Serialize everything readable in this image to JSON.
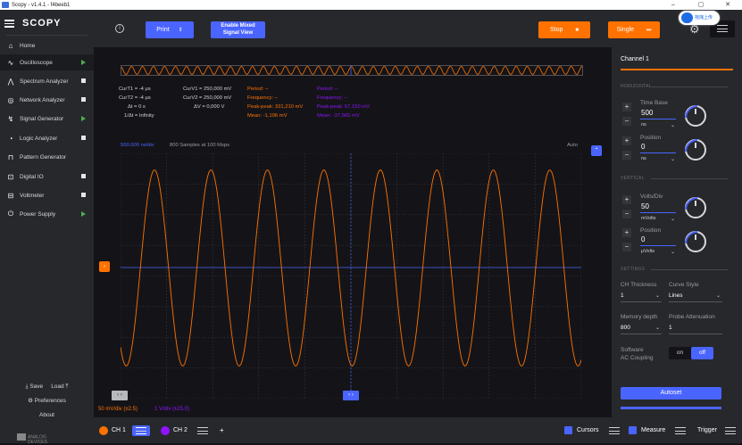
{
  "window": {
    "title": "Scopy - v1.4.1 - f4beeb1",
    "minimize": "–",
    "maximize": "▢",
    "close": "✕"
  },
  "overlay_badge": {
    "label": "拖拽上传"
  },
  "sidebar": {
    "brand": "SCOPY",
    "items": [
      {
        "label": "Home",
        "icon": "home-icon",
        "status": "none"
      },
      {
        "label": "Oscilloscope",
        "icon": "oscilloscope-icon",
        "status": "running"
      },
      {
        "label": "Spectrum Analyzer",
        "icon": "spectrum-icon",
        "status": "stopped"
      },
      {
        "label": "Network Analyzer",
        "icon": "network-icon",
        "status": "stopped"
      },
      {
        "label": "Signal Generator",
        "icon": "signal-generator-icon",
        "status": "running"
      },
      {
        "label": "Logic Analyzer",
        "icon": "logic-analyzer-icon",
        "status": "stopped"
      },
      {
        "label": "Pattern Generator",
        "icon": "pattern-generator-icon",
        "status": "none"
      },
      {
        "label": "Digital IO",
        "icon": "digital-io-icon",
        "status": "stopped"
      },
      {
        "label": "Voltmeter",
        "icon": "voltmeter-icon",
        "status": "stopped"
      },
      {
        "label": "Power Supply",
        "icon": "power-supply-icon",
        "status": "running"
      }
    ],
    "save": "Save",
    "load": "Load",
    "preferences": "Preferences",
    "about": "About",
    "vendor_line1": "ANALOG",
    "vendor_line2": "DEVICES"
  },
  "toolbar": {
    "info_icon": "i",
    "print_label": "Print",
    "mixed_signal_line1": "Enable Mixed",
    "mixed_signal_line2": "Signal View",
    "stop_label": "Stop",
    "single_label": "Single"
  },
  "readouts": {
    "cursors": {
      "cur_t1": "CurT1 = -4 μs",
      "cur_t2": "CurT2 = -4 μs",
      "delta_t": "Δt = 0 s",
      "inv_delta_t": "1/Δt = Infinity",
      "cur_v1": "CurV1 = 250,000 mV",
      "cur_v2": "CurV2 = 250,000 mV",
      "delta_v": "ΔV = 0,000 V"
    },
    "ch1": {
      "period": "Period:     –",
      "frequency": "Frequency:  –",
      "peak_peak": "Peak-peak: 331,210 mV",
      "mean": "Mean:          -1,106 mV"
    },
    "ch2": {
      "period": "Period:     –",
      "frequency": "Frequency:  –",
      "peak_peak": "Peak-peak: 57,150 mV",
      "mean": "Mean:          -37,565 mV"
    }
  },
  "plot": {
    "timebase_label": "500.000 ns/div",
    "samples_label": "800  Samples at 100 Msps",
    "trigger_mode": "Auto",
    "ch1_scale": "50 mV/div (±2.5)",
    "ch2_scale": "1  V/div (±25.0)",
    "waveform": {
      "ch1_cycles": 8,
      "ch1_amplitude_divs": 3.2
    }
  },
  "right_panel": {
    "title": "Channel 1",
    "horizontal_section": "HORIZONTAL",
    "time_base_label": "Time Base",
    "time_base_value": "500",
    "time_base_unit": "ns",
    "h_position_label": "Position",
    "h_position_value": "0",
    "h_position_unit": "ns",
    "vertical_section": "VERTICAL",
    "volts_div_label": "Volts/Div",
    "volts_div_value": "50",
    "volts_div_unit": "mVolts",
    "v_position_label": "Position",
    "v_position_value": "0",
    "v_position_unit": "μVolts",
    "settings_section": "SETTINGS",
    "ch_thickness_label": "CH Thickness",
    "ch_thickness_value": "1",
    "curve_style_label": "Curve Style",
    "curve_style_value": "Lines",
    "memory_depth_label": "Memory depth",
    "memory_depth_value": "800",
    "probe_attenuation_label": "Probe Attenuation",
    "probe_attenuation_value": "1",
    "sw_coupling_line1": "Software",
    "sw_coupling_line2": "AC Coupling",
    "toggle_on": "on",
    "toggle_off": "off",
    "autoset_label": "Autoset"
  },
  "bottom_bar": {
    "ch1_label": "CH 1",
    "ch2_label": "CH 2",
    "add_label": "+",
    "cursors_label": "Cursors",
    "measure_label": "Measure",
    "trigger_label": "Trigger"
  },
  "colors": {
    "ch1": "#ff7200",
    "ch2": "#9013fe",
    "accent": "#4a64ff",
    "panel": "#27282c",
    "bg": "#141418"
  }
}
